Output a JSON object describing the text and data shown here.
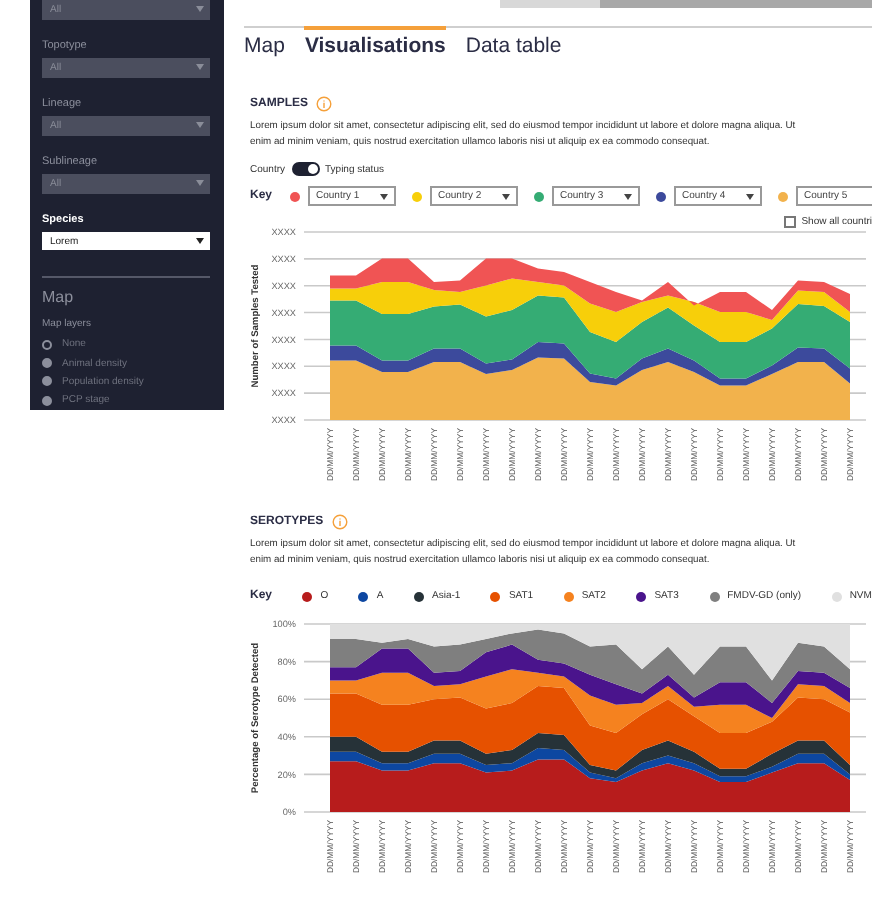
{
  "sidebar": {
    "filters": [
      {
        "value": "All",
        "disabled": true
      },
      {
        "label": "Topotype",
        "value": "All",
        "disabled": true
      },
      {
        "label": "Lineage",
        "value": "All",
        "disabled": true
      },
      {
        "label": "Sublineage",
        "value": "All",
        "disabled": true
      },
      {
        "label": "Species",
        "value": "Lorem",
        "disabled": false
      }
    ],
    "map": {
      "title": "Map",
      "layers_label": "Map layers",
      "layers": [
        {
          "label": "None",
          "selected": true
        },
        {
          "label": "Animal density",
          "selected": false
        },
        {
          "label": "Population density",
          "selected": false
        },
        {
          "label": "PCP stage",
          "selected": false
        }
      ]
    }
  },
  "tabs": [
    {
      "label": "Map",
      "selected": false
    },
    {
      "label": "Visualisations",
      "selected": true
    },
    {
      "label": "Data table",
      "selected": false
    }
  ],
  "samples": {
    "title": "SAMPLES",
    "description": "Lorem ipsum dolor sit amet, consectetur adipiscing elit, sed do eiusmod tempor incididunt ut labore et dolore magna aliqua. Ut enim ad minim veniam, quis nostrud exercitation ullamco laboris nisi ut aliquip ex ea commodo consequat.",
    "toggle": {
      "left": "Country",
      "right": "Typing status",
      "on": true
    },
    "key_label": "Key",
    "key": [
      {
        "value": "Country 1",
        "color": "#f05454"
      },
      {
        "value": "Country 2",
        "color": "#f7cf0a"
      },
      {
        "value": "Country 3",
        "color": "#35ac74"
      },
      {
        "value": "Country 4",
        "color": "#3c4a9c"
      },
      {
        "value": "Country 5",
        "color": "#f2b24c"
      }
    ],
    "show_all": {
      "label": "Show all countri",
      "checked": false
    },
    "chart": {
      "ylabel": "Number of Samples Tested",
      "yticks": [
        "XXXX",
        "XXXX",
        "XXXX",
        "XXXX",
        "XXXX",
        "XXXX",
        "XXXX",
        "XXXX"
      ],
      "xlabels": [
        "DD/MM/YYYY",
        "DD/MM/YYYY",
        "DD/MM/YYYY",
        "DD/MM/YYYY",
        "DD/MM/YYYY",
        "DD/MM/YYYY",
        "DD/MM/YYYY",
        "DD/MM/YYYY",
        "DD/MM/YYYY",
        "DD/MM/YYYY",
        "DD/MM/YYYY",
        "DD/MM/YYYY",
        "DD/MM/YYYY",
        "DD/MM/YYYY",
        "DD/MM/YYYY",
        "DD/MM/YYYY",
        "DD/MM/YYYY",
        "DD/MM/YYYY",
        "DD/MM/YYYY",
        "DD/MM/YYYY",
        "DD/MM/YYYY"
      ]
    }
  },
  "serotypes": {
    "title": "SEROTYPES",
    "description": "Lorem ipsum dolor sit amet, consectetur adipiscing elit, sed do eiusmod tempor incididunt ut labore et dolore magna aliqua. Ut enim ad minim veniam, quis nostrud exercitation ullamco laboris nisi ut aliquip ex ea commodo consequat.",
    "key_label": "Key",
    "chart_data": {
      "type": "area",
      "stacked": true,
      "grid": true,
      "ylabel": "Percentage of Serotype Detected",
      "ylim": [
        0,
        100
      ],
      "yticks": [
        {
          "value": 0,
          "label": "0%"
        },
        {
          "value": 20,
          "label": "20%"
        },
        {
          "value": 40,
          "label": "40%"
        },
        {
          "value": 60,
          "label": "60%"
        },
        {
          "value": 80,
          "label": "80%"
        },
        {
          "value": 100,
          "label": "100%"
        }
      ],
      "categories": [
        "DD/MM/YYYY",
        "DD/MM/YYYY",
        "DD/MM/YYYY",
        "DD/MM/YYYY",
        "DD/MM/YYYY",
        "DD/MM/YYYY",
        "DD/MM/YYYY",
        "DD/MM/YYYY",
        "DD/MM/YYYY",
        "DD/MM/YYYY",
        "DD/MM/YYYY",
        "DD/MM/YYYY",
        "DD/MM/YYYY",
        "DD/MM/YYYY",
        "DD/MM/YYYY",
        "DD/MM/YYYY",
        "DD/MM/YYYY",
        "DD/MM/YYYY",
        "DD/MM/YYYY",
        "DD/MM/YYYY",
        "DD/MM/YYYY"
      ],
      "series": [
        {
          "name": "O",
          "color": "#b71c1c",
          "values": [
            27,
            27,
            22,
            22,
            26,
            26,
            21,
            22,
            28,
            28,
            18,
            16,
            22,
            26,
            22,
            16,
            16,
            21,
            26,
            26,
            17
          ]
        },
        {
          "name": "A",
          "color": "#0d47a1",
          "values": [
            5,
            5,
            4,
            4,
            5,
            5,
            4,
            4,
            6,
            5,
            3,
            2,
            4,
            4,
            4,
            3,
            3,
            3,
            5,
            5,
            3
          ]
        },
        {
          "name": "Asia-1",
          "color": "#263238",
          "values": [
            8,
            8,
            6,
            6,
            7,
            7,
            6,
            7,
            8,
            8,
            4,
            4,
            7,
            8,
            6,
            4,
            4,
            7,
            7,
            7,
            5
          ]
        },
        {
          "name": "SAT1",
          "color": "#e65100",
          "values": [
            23,
            23,
            25,
            25,
            22,
            23,
            24,
            25,
            25,
            25,
            21,
            20,
            19,
            22,
            19,
            19,
            19,
            17,
            23,
            22,
            28
          ]
        },
        {
          "name": "SAT2",
          "color": "#f5821f",
          "values": [
            7,
            7,
            17,
            17,
            7,
            7,
            17,
            18,
            7,
            6,
            16,
            15,
            6,
            7,
            5,
            15,
            15,
            2,
            7,
            7,
            5
          ]
        },
        {
          "name": "SAT3",
          "color": "#4a148c",
          "values": [
            7,
            7,
            13,
            13,
            7,
            7,
            13,
            13,
            7,
            7,
            11,
            11,
            5,
            6,
            5,
            12,
            12,
            8,
            7,
            7,
            8
          ]
        },
        {
          "name": "FMDV-GD (only)",
          "color": "#7f7f7f",
          "values": [
            15,
            15,
            3,
            5,
            14,
            14,
            7,
            6,
            16,
            16,
            15,
            21,
            13,
            15,
            12,
            19,
            19,
            12,
            15,
            14,
            10
          ]
        },
        {
          "name": "NVM",
          "color": "#e0e0e0",
          "values": [
            8,
            8,
            10,
            8,
            12,
            11,
            8,
            5,
            3,
            5,
            12,
            11,
            24,
            12,
            27,
            12,
            12,
            30,
            10,
            12,
            24
          ]
        }
      ]
    }
  }
}
